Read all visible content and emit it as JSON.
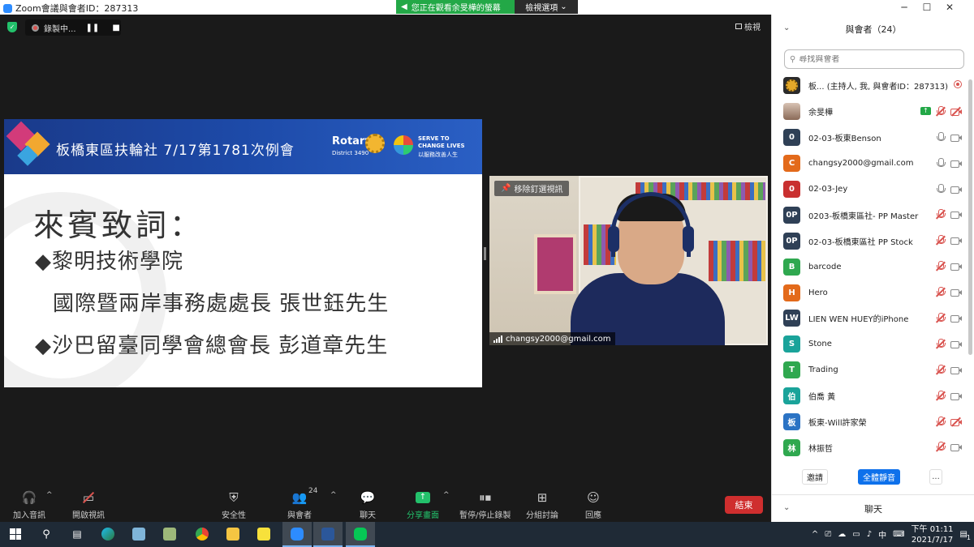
{
  "window": {
    "title": "Zoom會議與會者ID：287313",
    "viewing_banner": "您正在觀看余旻樺的螢幕",
    "view_options": "檢視選項",
    "controls": [
      "─",
      "☐",
      "✕"
    ]
  },
  "meeting": {
    "recording_label": "錄製中...",
    "view_label": "檢視"
  },
  "slide": {
    "club_title": "板橋東區扶輪社   7/17第1781次例會",
    "rotary_label": "Rotary",
    "district_label": "District 3490",
    "serve_line1": "SERVE TO",
    "serve_line2": "CHANGE LIVES",
    "serve_line3": "以服務改善人生",
    "heading": "來賓致詞：",
    "lines": [
      "◆黎明技術學院",
      "國際暨兩岸事務處處長 張世鈺先生",
      "◆沙巴留臺同學會總會長 彭道章先生"
    ]
  },
  "video": {
    "pin_label": "移除釘選視訊",
    "participant_name": "changsy2000@gmail.com"
  },
  "toolbar": {
    "items": [
      {
        "label": "加入音訊",
        "icon": "headphones-icon"
      },
      {
        "label": "開啟視訊",
        "icon": "video-off-icon"
      },
      {
        "label": "安全性",
        "icon": "shield-icon"
      },
      {
        "label": "與會者",
        "icon": "participants-icon",
        "count": "24"
      },
      {
        "label": "聊天",
        "icon": "chat-icon"
      },
      {
        "label": "分享畫面",
        "icon": "share-screen-icon"
      },
      {
        "label": "暫停/停止錄製",
        "icon": "pause-stop-icon"
      },
      {
        "label": "分組討論",
        "icon": "breakout-icon"
      },
      {
        "label": "回應",
        "icon": "reaction-icon"
      }
    ],
    "end_label": "結束"
  },
  "panel": {
    "title": "與會者（24）",
    "search_placeholder": "尋找與會者",
    "participants": [
      {
        "avatar": "",
        "type": "rotary",
        "name": "板...    (主持人, 我, 與會者ID：287313)",
        "mic": "rec",
        "cam": "none"
      },
      {
        "avatar": "",
        "type": "photo",
        "name": "余旻樺",
        "share": true,
        "mic": "muted",
        "cam": "off"
      },
      {
        "avatar": "0",
        "color": "#2f4056",
        "name": "02-03-板東Benson",
        "mic": "on",
        "cam": "on"
      },
      {
        "avatar": "C",
        "color": "#e36a1b",
        "name": "changsy2000@gmail.com",
        "mic": "on",
        "cam": "on"
      },
      {
        "avatar": "0",
        "color": "#c93030",
        "name": "02-03-Jey",
        "mic": "on",
        "cam": "on"
      },
      {
        "avatar": "0P",
        "color": "#2f4056",
        "name": "0203-板橋東區社- PP Master",
        "mic": "muted",
        "cam": "on"
      },
      {
        "avatar": "0P",
        "color": "#2f4056",
        "name": "02-03-板橋東區社 PP Stock",
        "mic": "muted",
        "cam": "on"
      },
      {
        "avatar": "B",
        "color": "#2fa84f",
        "name": "barcode",
        "mic": "muted",
        "cam": "on"
      },
      {
        "avatar": "H",
        "color": "#e36a1b",
        "name": "Hero",
        "mic": "muted",
        "cam": "on"
      },
      {
        "avatar": "LW",
        "color": "#2f4056",
        "name": "LIEN WEN HUEY的iPhone",
        "mic": "muted",
        "cam": "on"
      },
      {
        "avatar": "S",
        "color": "#1aa39a",
        "name": "Stone",
        "mic": "muted",
        "cam": "on"
      },
      {
        "avatar": "T",
        "color": "#2fa84f",
        "name": "Trading",
        "mic": "muted",
        "cam": "on"
      },
      {
        "avatar": "伯",
        "color": "#1aa39a",
        "name": "伯喬 黃",
        "mic": "muted",
        "cam": "on"
      },
      {
        "avatar": "板",
        "color": "#2b73c4",
        "name": "板東-Will許家榮",
        "mic": "muted",
        "cam": "off"
      },
      {
        "avatar": "林",
        "color": "#2fa84f",
        "name": "林振哲",
        "mic": "muted",
        "cam": "on"
      }
    ],
    "invite_label": "邀請",
    "mute_all_label": "全體靜音",
    "more_label": "...",
    "chat_label": "聊天"
  },
  "taskbar": {
    "time": "下午 01:11",
    "date": "2021/7/17",
    "notification_count": "1"
  },
  "colors": {
    "accent_green": "#23c16b",
    "accent_blue": "#0e71eb",
    "end_red": "#cf2e2e",
    "muted_red": "#d9534f"
  }
}
